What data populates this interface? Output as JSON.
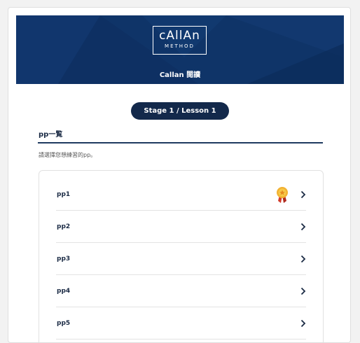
{
  "header": {
    "logo_main": "cAllAn",
    "logo_sub": "METHOD",
    "title": "Callan 閱讀"
  },
  "stage": {
    "label": "Stage 1 / Lesson 1"
  },
  "section": {
    "title": "pp一覧",
    "instruction": "請選擇您想練習的pp。"
  },
  "list": {
    "items": [
      {
        "label": "pp1",
        "badge": "medal-icon"
      },
      {
        "label": "pp2"
      },
      {
        "label": "pp3"
      },
      {
        "label": "pp4"
      },
      {
        "label": "pp5"
      }
    ]
  },
  "colors": {
    "header_bg": "#0f3468",
    "pill_bg": "#13294b",
    "text_dark": "#1a2a44"
  }
}
